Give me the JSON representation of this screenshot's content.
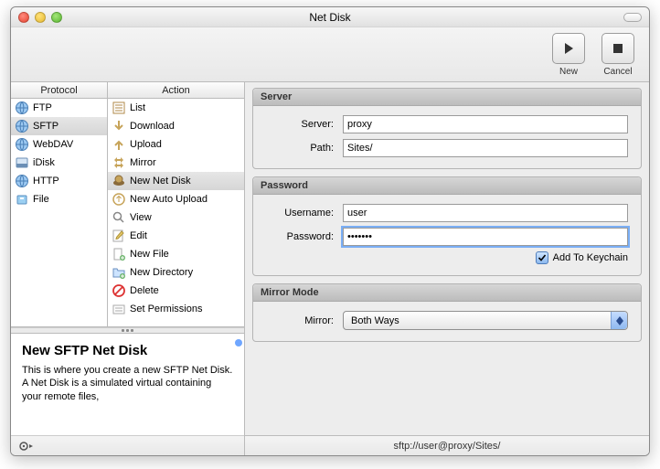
{
  "window": {
    "title": "Net Disk"
  },
  "toolbar": {
    "new_label": "New",
    "cancel_label": "Cancel"
  },
  "columns": {
    "protocol_header": "Protocol",
    "action_header": "Action"
  },
  "protocols": [
    {
      "label": "FTP",
      "icon": "globe"
    },
    {
      "label": "SFTP",
      "icon": "globe",
      "selected": true
    },
    {
      "label": "WebDAV",
      "icon": "globe"
    },
    {
      "label": "iDisk",
      "icon": "idisk"
    },
    {
      "label": "HTTP",
      "icon": "globe"
    },
    {
      "label": "File",
      "icon": "file"
    }
  ],
  "actions": [
    {
      "label": "List",
      "icon": "list"
    },
    {
      "label": "Download",
      "icon": "download"
    },
    {
      "label": "Upload",
      "icon": "upload"
    },
    {
      "label": "Mirror",
      "icon": "mirror"
    },
    {
      "label": "New Net Disk",
      "icon": "netdisk",
      "selected": true
    },
    {
      "label": "New Auto Upload",
      "icon": "autoupload"
    },
    {
      "label": "View",
      "icon": "view"
    },
    {
      "label": "Edit",
      "icon": "edit"
    },
    {
      "label": "New File",
      "icon": "newfile"
    },
    {
      "label": "New Directory",
      "icon": "newdir"
    },
    {
      "label": "Delete",
      "icon": "delete"
    },
    {
      "label": "Set Permissions",
      "icon": "permissions"
    }
  ],
  "description": {
    "title": "New SFTP Net Disk",
    "body": "This is where you create a new SFTP Net Disk.  A Net Disk is a simulated virtual containing your remote files,"
  },
  "form": {
    "server_section": "Server",
    "password_section": "Password",
    "mirror_section": "Mirror Mode",
    "server_label": "Server:",
    "path_label": "Path:",
    "username_label": "Username:",
    "password_label": "Password:",
    "mirror_label": "Mirror:",
    "server_value": "proxy",
    "path_value": "Sites/",
    "username_value": "user",
    "password_value": "•••••••",
    "keychain_label": "Add To Keychain",
    "keychain_checked": true,
    "mirror_selected": "Both Ways"
  },
  "status": {
    "text": "sftp://user@proxy/Sites/"
  }
}
